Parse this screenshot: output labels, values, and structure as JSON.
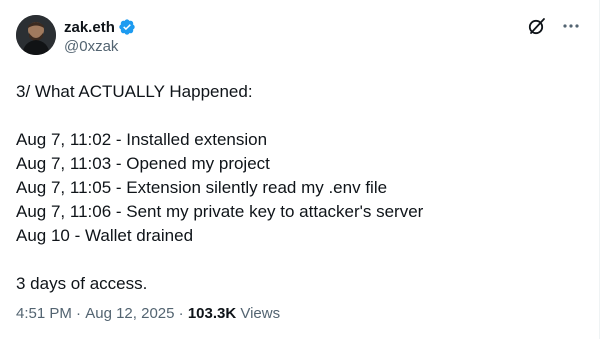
{
  "author": {
    "display_name": "zak.eth",
    "handle": "@0xzak",
    "verified": true
  },
  "tweet": {
    "lines": [
      "3/ What ACTUALLY Happened:",
      "",
      "Aug 7, 11:02 - Installed extension",
      "Aug 7, 11:03 - Opened my project",
      "Aug 7, 11:05 - Extension silently read my .env file",
      "Aug 7, 11:06 - Sent my private key to attacker's server",
      "Aug 10 - Wallet drained",
      "",
      "3 days of access."
    ]
  },
  "meta": {
    "time": "4:51 PM",
    "separator": " · ",
    "date": "Aug 12, 2025",
    "views_count": "103.3K",
    "views_label": "Views"
  },
  "icons": {
    "verified": "verified-badge-icon",
    "grok": "grok-icon",
    "more": "more-options-icon"
  },
  "colors": {
    "verified_blue": "#1d9bf0",
    "text_primary": "#0f1419",
    "text_secondary": "#536471"
  }
}
